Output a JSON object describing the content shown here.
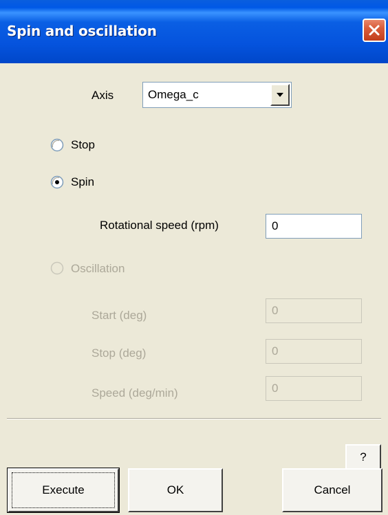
{
  "window": {
    "title": "Spin and oscillation"
  },
  "axis": {
    "label": "Axis",
    "selected": "Omega_c"
  },
  "modes": {
    "stop_label": "Stop",
    "spin_label": "Spin",
    "oscillation_label": "Oscillation",
    "selected": "Spin"
  },
  "spin": {
    "speed_label": "Rotational speed (rpm)",
    "speed_value": "0"
  },
  "oscillation": {
    "start_label": "Start (deg)",
    "start_value": "0",
    "stop_label": "Stop (deg)",
    "stop_value": "0",
    "speed_label": "Speed (deg/min)",
    "speed_value": "0"
  },
  "buttons": {
    "help": "?",
    "execute": "Execute",
    "ok": "OK",
    "cancel": "Cancel"
  }
}
